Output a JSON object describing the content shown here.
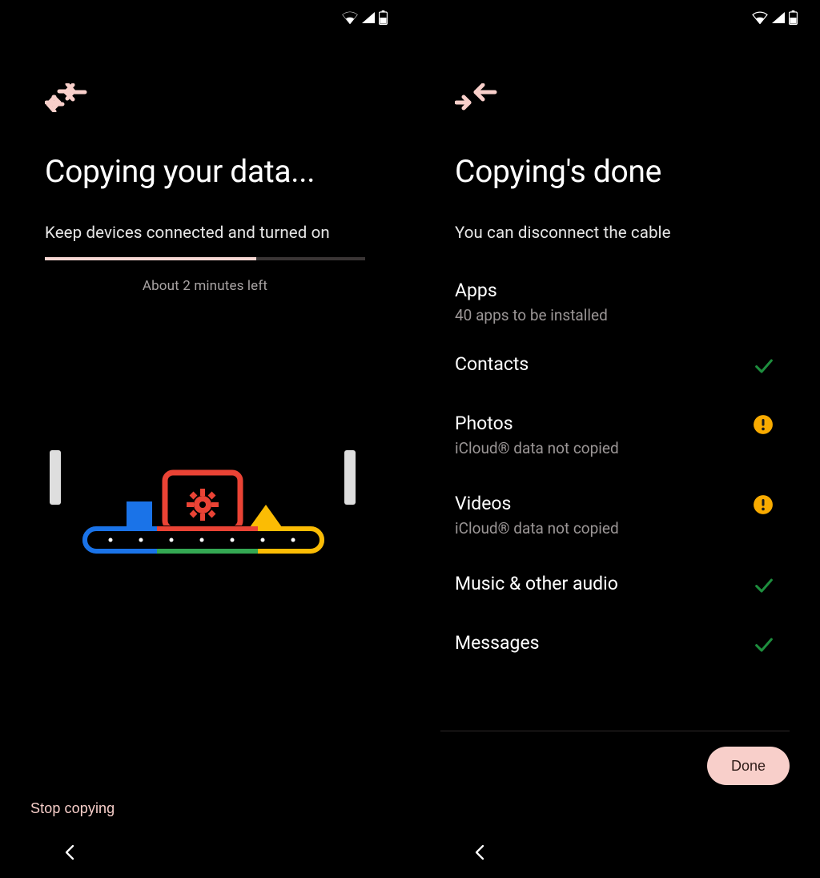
{
  "colors": {
    "accent_pink": "#f8cfca",
    "warning_amber": "#f9ab00",
    "success_green": "#1e8e3e",
    "google_blue": "#1a73e8",
    "google_red": "#ea4335",
    "google_yellow": "#fbbc04",
    "google_green": "#34a853"
  },
  "left": {
    "title": "Copying your data...",
    "subtitle": "Keep devices connected and turned on",
    "progress_percent": 66,
    "time_left": "About 2 minutes left",
    "stop_label": "Stop copying"
  },
  "right": {
    "title": "Copying's done",
    "subtitle": "You can disconnect the cable",
    "apps": {
      "title": "Apps",
      "sub": "40 apps to be installed"
    },
    "items": [
      {
        "title": "Contacts",
        "sub": "",
        "status": "check"
      },
      {
        "title": "Photos",
        "sub": "iCloud® data not copied",
        "status": "warn"
      },
      {
        "title": "Videos",
        "sub": "iCloud® data not copied",
        "status": "warn"
      },
      {
        "title": "Music & other audio",
        "sub": "",
        "status": "check"
      },
      {
        "title": "Messages",
        "sub": "",
        "status": "check"
      }
    ],
    "done_label": "Done"
  }
}
